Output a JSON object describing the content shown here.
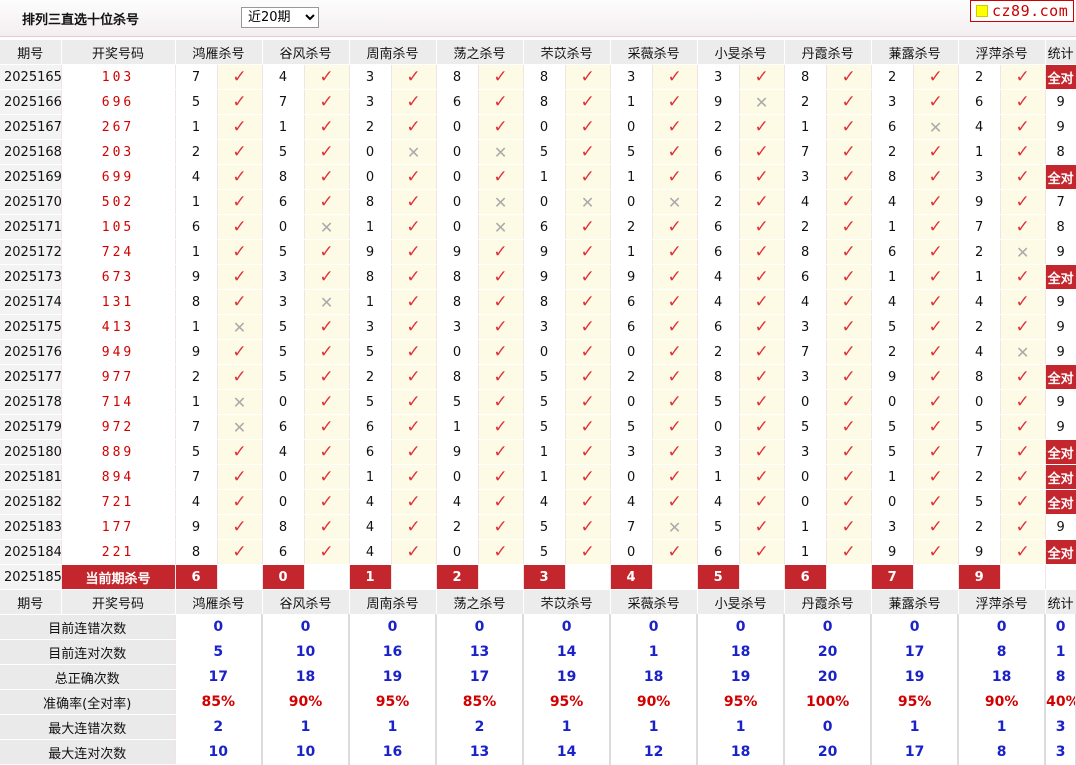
{
  "header": {
    "title": "排列三直选十位杀号",
    "select_value": "近20期",
    "logo_text": "cz89.com"
  },
  "columns": {
    "period": "期号",
    "draw": "开奖号码",
    "experts": [
      "鸿雁杀号",
      "谷风杀号",
      "周南杀号",
      "荡之杀号",
      "芣苡杀号",
      "采薇杀号",
      "小旻杀号",
      "丹霞杀号",
      "蒹露杀号",
      "浮萍杀号"
    ],
    "stat": "统计"
  },
  "rows": [
    {
      "period": "2025165",
      "draw": "103",
      "picks": [
        [
          7,
          1
        ],
        [
          4,
          1
        ],
        [
          3,
          1
        ],
        [
          8,
          1
        ],
        [
          8,
          1
        ],
        [
          3,
          1
        ],
        [
          3,
          1
        ],
        [
          8,
          1
        ],
        [
          2,
          1
        ],
        [
          2,
          1
        ]
      ],
      "stat": "全对"
    },
    {
      "period": "2025166",
      "draw": "696",
      "picks": [
        [
          5,
          1
        ],
        [
          7,
          1
        ],
        [
          3,
          1
        ],
        [
          6,
          1
        ],
        [
          8,
          1
        ],
        [
          1,
          1
        ],
        [
          9,
          0
        ],
        [
          2,
          1
        ],
        [
          3,
          1
        ],
        [
          6,
          1
        ]
      ],
      "stat": "9"
    },
    {
      "period": "2025167",
      "draw": "267",
      "picks": [
        [
          1,
          1
        ],
        [
          1,
          1
        ],
        [
          2,
          1
        ],
        [
          0,
          1
        ],
        [
          0,
          1
        ],
        [
          0,
          1
        ],
        [
          2,
          1
        ],
        [
          1,
          1
        ],
        [
          6,
          0
        ],
        [
          4,
          1
        ]
      ],
      "stat": "9"
    },
    {
      "period": "2025168",
      "draw": "203",
      "picks": [
        [
          2,
          1
        ],
        [
          5,
          1
        ],
        [
          0,
          0
        ],
        [
          0,
          0
        ],
        [
          5,
          1
        ],
        [
          5,
          1
        ],
        [
          6,
          1
        ],
        [
          7,
          1
        ],
        [
          2,
          1
        ],
        [
          1,
          1
        ]
      ],
      "stat": "8"
    },
    {
      "period": "2025169",
      "draw": "699",
      "picks": [
        [
          4,
          1
        ],
        [
          8,
          1
        ],
        [
          0,
          1
        ],
        [
          0,
          1
        ],
        [
          1,
          1
        ],
        [
          1,
          1
        ],
        [
          6,
          1
        ],
        [
          3,
          1
        ],
        [
          8,
          1
        ],
        [
          3,
          1
        ]
      ],
      "stat": "全对"
    },
    {
      "period": "2025170",
      "draw": "502",
      "picks": [
        [
          1,
          1
        ],
        [
          6,
          1
        ],
        [
          8,
          1
        ],
        [
          0,
          0
        ],
        [
          0,
          0
        ],
        [
          0,
          0
        ],
        [
          2,
          1
        ],
        [
          4,
          1
        ],
        [
          4,
          1
        ],
        [
          9,
          1
        ]
      ],
      "stat": "7"
    },
    {
      "period": "2025171",
      "draw": "105",
      "picks": [
        [
          6,
          1
        ],
        [
          0,
          0
        ],
        [
          1,
          1
        ],
        [
          0,
          0
        ],
        [
          6,
          1
        ],
        [
          2,
          1
        ],
        [
          6,
          1
        ],
        [
          2,
          1
        ],
        [
          1,
          1
        ],
        [
          7,
          1
        ]
      ],
      "stat": "8"
    },
    {
      "period": "2025172",
      "draw": "724",
      "picks": [
        [
          1,
          1
        ],
        [
          5,
          1
        ],
        [
          9,
          1
        ],
        [
          9,
          1
        ],
        [
          9,
          1
        ],
        [
          1,
          1
        ],
        [
          6,
          1
        ],
        [
          8,
          1
        ],
        [
          6,
          1
        ],
        [
          2,
          0
        ]
      ],
      "stat": "9"
    },
    {
      "period": "2025173",
      "draw": "673",
      "picks": [
        [
          9,
          1
        ],
        [
          3,
          1
        ],
        [
          8,
          1
        ],
        [
          8,
          1
        ],
        [
          9,
          1
        ],
        [
          9,
          1
        ],
        [
          4,
          1
        ],
        [
          6,
          1
        ],
        [
          1,
          1
        ],
        [
          1,
          1
        ]
      ],
      "stat": "全对"
    },
    {
      "period": "2025174",
      "draw": "131",
      "picks": [
        [
          8,
          1
        ],
        [
          3,
          0
        ],
        [
          1,
          1
        ],
        [
          8,
          1
        ],
        [
          8,
          1
        ],
        [
          6,
          1
        ],
        [
          4,
          1
        ],
        [
          4,
          1
        ],
        [
          4,
          1
        ],
        [
          4,
          1
        ]
      ],
      "stat": "9"
    },
    {
      "period": "2025175",
      "draw": "413",
      "picks": [
        [
          1,
          0
        ],
        [
          5,
          1
        ],
        [
          3,
          1
        ],
        [
          3,
          1
        ],
        [
          3,
          1
        ],
        [
          6,
          1
        ],
        [
          6,
          1
        ],
        [
          3,
          1
        ],
        [
          5,
          1
        ],
        [
          2,
          1
        ]
      ],
      "stat": "9"
    },
    {
      "period": "2025176",
      "draw": "949",
      "picks": [
        [
          9,
          1
        ],
        [
          5,
          1
        ],
        [
          5,
          1
        ],
        [
          0,
          1
        ],
        [
          0,
          1
        ],
        [
          0,
          1
        ],
        [
          2,
          1
        ],
        [
          7,
          1
        ],
        [
          2,
          1
        ],
        [
          4,
          0
        ]
      ],
      "stat": "9"
    },
    {
      "period": "2025177",
      "draw": "977",
      "picks": [
        [
          2,
          1
        ],
        [
          5,
          1
        ],
        [
          2,
          1
        ],
        [
          8,
          1
        ],
        [
          5,
          1
        ],
        [
          2,
          1
        ],
        [
          8,
          1
        ],
        [
          3,
          1
        ],
        [
          9,
          1
        ],
        [
          8,
          1
        ]
      ],
      "stat": "全对"
    },
    {
      "period": "2025178",
      "draw": "714",
      "picks": [
        [
          1,
          0
        ],
        [
          0,
          1
        ],
        [
          5,
          1
        ],
        [
          5,
          1
        ],
        [
          5,
          1
        ],
        [
          0,
          1
        ],
        [
          5,
          1
        ],
        [
          0,
          1
        ],
        [
          0,
          1
        ],
        [
          0,
          1
        ]
      ],
      "stat": "9"
    },
    {
      "period": "2025179",
      "draw": "972",
      "picks": [
        [
          7,
          0
        ],
        [
          6,
          1
        ],
        [
          6,
          1
        ],
        [
          1,
          1
        ],
        [
          5,
          1
        ],
        [
          5,
          1
        ],
        [
          0,
          1
        ],
        [
          5,
          1
        ],
        [
          5,
          1
        ],
        [
          5,
          1
        ]
      ],
      "stat": "9"
    },
    {
      "period": "2025180",
      "draw": "889",
      "picks": [
        [
          5,
          1
        ],
        [
          4,
          1
        ],
        [
          6,
          1
        ],
        [
          9,
          1
        ],
        [
          1,
          1
        ],
        [
          3,
          1
        ],
        [
          3,
          1
        ],
        [
          3,
          1
        ],
        [
          5,
          1
        ],
        [
          7,
          1
        ]
      ],
      "stat": "全对"
    },
    {
      "period": "2025181",
      "draw": "894",
      "picks": [
        [
          7,
          1
        ],
        [
          0,
          1
        ],
        [
          1,
          1
        ],
        [
          0,
          1
        ],
        [
          1,
          1
        ],
        [
          0,
          1
        ],
        [
          1,
          1
        ],
        [
          0,
          1
        ],
        [
          1,
          1
        ],
        [
          2,
          1
        ]
      ],
      "stat": "全对"
    },
    {
      "period": "2025182",
      "draw": "721",
      "picks": [
        [
          4,
          1
        ],
        [
          0,
          1
        ],
        [
          4,
          1
        ],
        [
          4,
          1
        ],
        [
          4,
          1
        ],
        [
          4,
          1
        ],
        [
          4,
          1
        ],
        [
          0,
          1
        ],
        [
          0,
          1
        ],
        [
          5,
          1
        ]
      ],
      "stat": "全对"
    },
    {
      "period": "2025183",
      "draw": "177",
      "picks": [
        [
          9,
          1
        ],
        [
          8,
          1
        ],
        [
          4,
          1
        ],
        [
          2,
          1
        ],
        [
          5,
          1
        ],
        [
          7,
          0
        ],
        [
          5,
          1
        ],
        [
          1,
          1
        ],
        [
          3,
          1
        ],
        [
          2,
          1
        ]
      ],
      "stat": "9"
    },
    {
      "period": "2025184",
      "draw": "221",
      "picks": [
        [
          8,
          1
        ],
        [
          6,
          1
        ],
        [
          4,
          1
        ],
        [
          0,
          1
        ],
        [
          5,
          1
        ],
        [
          0,
          1
        ],
        [
          6,
          1
        ],
        [
          1,
          1
        ],
        [
          9,
          1
        ],
        [
          9,
          1
        ]
      ],
      "stat": "全对"
    }
  ],
  "current": {
    "period": "2025185",
    "label": "当前期杀号",
    "picks": [
      "6",
      "0",
      "1",
      "2",
      "3",
      "4",
      "5",
      "6",
      "7",
      "9"
    ]
  },
  "marks": {
    "correct": "✓",
    "wrong": "✕"
  },
  "summary": [
    {
      "label": "目前连错次数",
      "values": [
        "0",
        "0",
        "0",
        "0",
        "0",
        "0",
        "0",
        "0",
        "0",
        "0",
        "0"
      ],
      "red": false
    },
    {
      "label": "目前连对次数",
      "values": [
        "5",
        "10",
        "16",
        "13",
        "14",
        "1",
        "18",
        "20",
        "17",
        "8",
        "1"
      ],
      "red": false
    },
    {
      "label": "总正确次数",
      "values": [
        "17",
        "18",
        "19",
        "17",
        "19",
        "18",
        "19",
        "20",
        "19",
        "18",
        "8"
      ],
      "red": false
    },
    {
      "label": "准确率(全对率)",
      "values": [
        "85%",
        "90%",
        "95%",
        "85%",
        "95%",
        "90%",
        "95%",
        "100%",
        "95%",
        "90%",
        "40%"
      ],
      "red": true
    },
    {
      "label": "最大连错次数",
      "values": [
        "2",
        "1",
        "1",
        "2",
        "1",
        "1",
        "1",
        "0",
        "1",
        "1",
        "3"
      ],
      "red": false
    },
    {
      "label": "最大连对次数",
      "values": [
        "10",
        "10",
        "16",
        "13",
        "14",
        "12",
        "18",
        "20",
        "17",
        "8",
        "3"
      ],
      "red": false
    }
  ],
  "colors": {
    "accent_red": "#c3262c",
    "check_red": "#e0303a",
    "summary_blue": "#1a22c8"
  }
}
